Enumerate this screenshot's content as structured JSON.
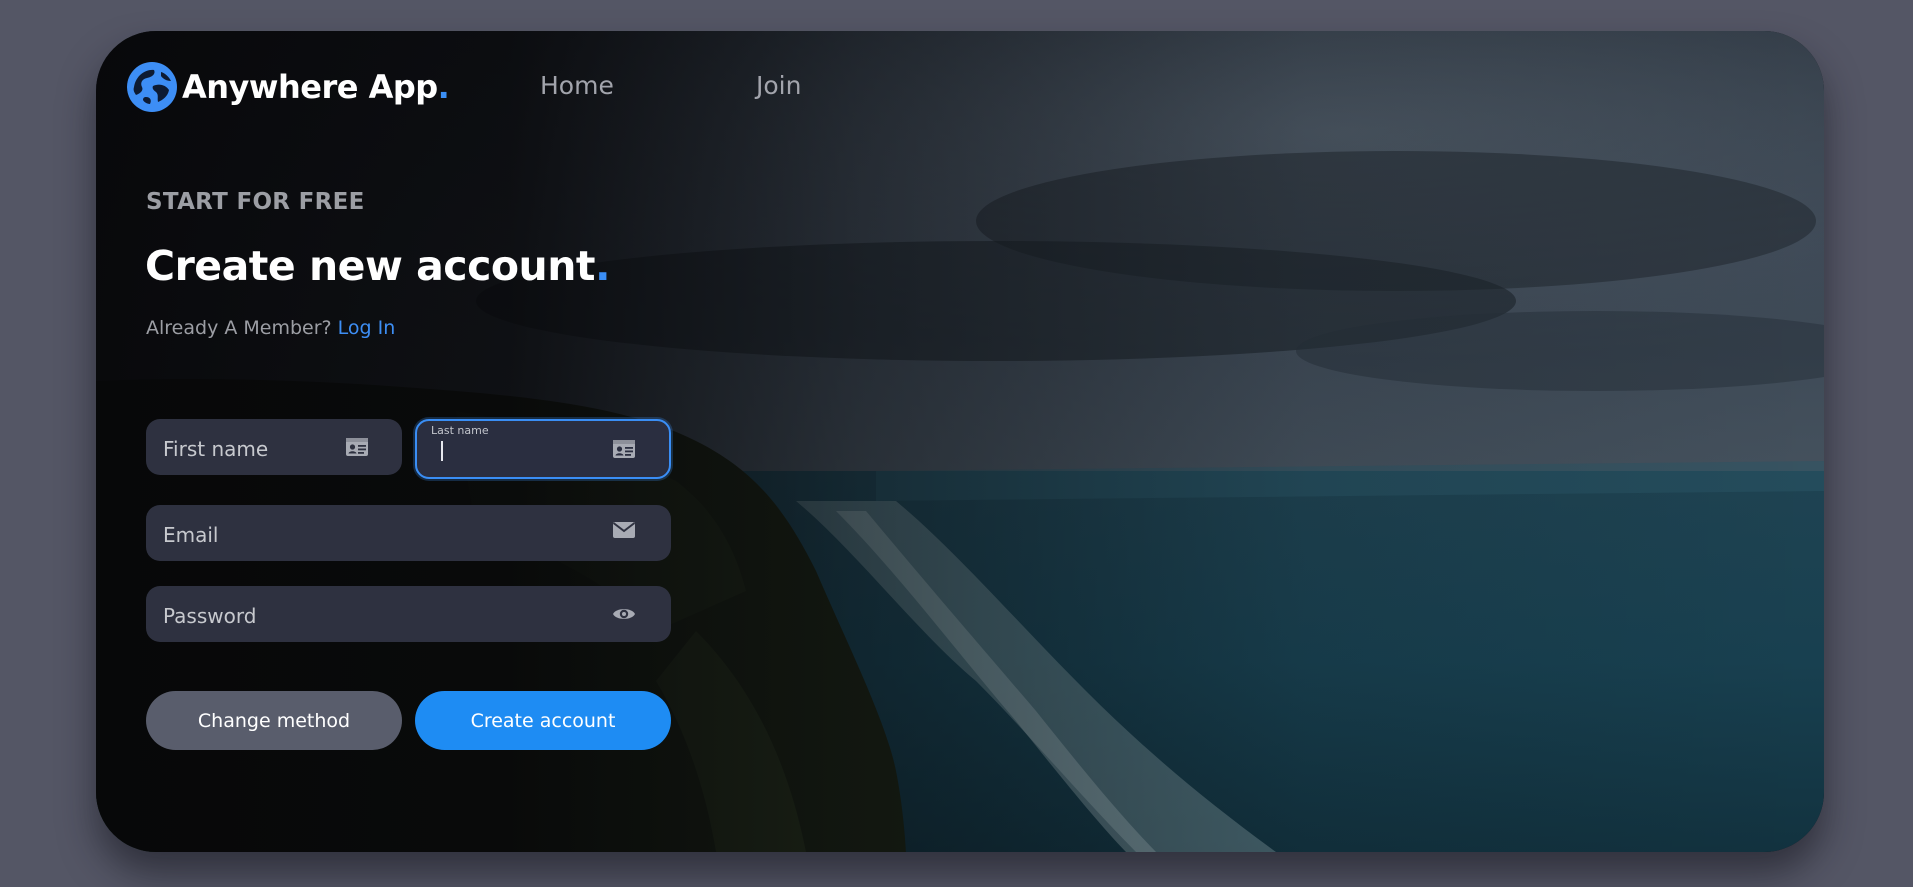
{
  "app": {
    "name": "Anywhere App",
    "brand_dot": "."
  },
  "nav": {
    "items": [
      {
        "label": "Home"
      },
      {
        "label": "Join"
      }
    ]
  },
  "hero": {
    "eyebrow": "START FOR FREE",
    "title": "Create new account",
    "title_dot": ".",
    "member_prompt": "Already A Member? ",
    "login_link": "Log In"
  },
  "form": {
    "first_name": {
      "label": "First name",
      "icon": "id-card-icon"
    },
    "last_name": {
      "label": "Last name",
      "value": "",
      "icon": "id-card-icon",
      "focused": true
    },
    "email": {
      "label": "Email",
      "icon": "envelope-icon"
    },
    "password": {
      "label": "Password",
      "icon": "eye-icon"
    }
  },
  "buttons": {
    "change_method": "Change method",
    "create_account": "Create account"
  },
  "colors": {
    "accent": "#3a8ef5",
    "primary_button": "#1e8cf3",
    "secondary_button": "#595d6c",
    "field_bg": "#2e3140",
    "page_bg": "#545665"
  }
}
